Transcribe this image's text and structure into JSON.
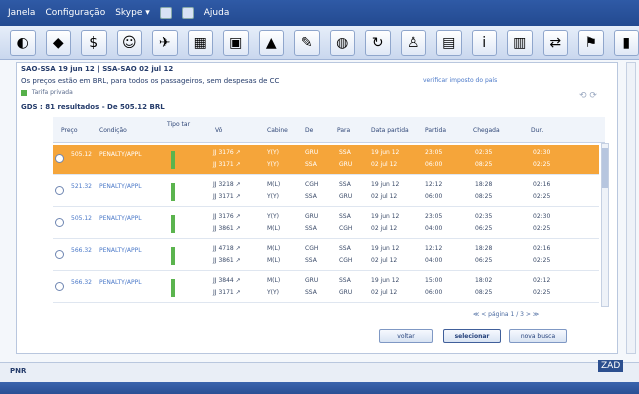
{
  "menubar": {
    "items": [
      "Janela",
      "Configuração",
      "Skype ▾",
      "Ajuda"
    ]
  },
  "toolbar": {
    "icons": [
      "app-icon",
      "shield-icon",
      "dollar-icon",
      "people-icon",
      "plane-icon",
      "calendar-icon",
      "print-icon",
      "chart-icon",
      "tools-icon",
      "globe-icon",
      "refresh-icon",
      "user-icon",
      "browser-icon",
      "info-icon",
      "book-icon",
      "exchange-icon",
      "flag-icon",
      "lock-icon"
    ]
  },
  "header": {
    "route": "SAO-SSA 19 jun 12 | SSA-SAO 02 jul 12",
    "note": "Os preços estão em BRL, para todos os passageiros, sem despesas de CC",
    "link": "verificar imposto do país"
  },
  "legend": {
    "label": "Tarifa privada"
  },
  "results": {
    "summary": "GDS : 81 resultados - De 505.12 BRL"
  },
  "table": {
    "headers": [
      "Preço",
      "Condição",
      "Tipo tar",
      "Vô",
      "Cabine",
      "De",
      "Para",
      "Data partida",
      "Partida",
      "Chegada",
      "Dur."
    ],
    "rows": [
      {
        "price": "505.12",
        "condition": "PENALTY/APPL",
        "flights": [
          "JJ 3176 ↗",
          "JJ 3171 ↗"
        ],
        "cabin": [
          "Y(Y)",
          "Y(Y)"
        ],
        "from": [
          "GRU",
          "SSA"
        ],
        "to": [
          "SSA",
          "GRU"
        ],
        "date": [
          "19 jun 12",
          "02 jul 12"
        ],
        "dep": [
          "23:05",
          "06:00"
        ],
        "arr": [
          "02:35",
          "08:25"
        ],
        "dur": [
          "02:30",
          "02:25"
        ],
        "selected": true
      },
      {
        "price": "521.32",
        "condition": "PENALTY/APPL",
        "flights": [
          "JJ 3218 ↗",
          "JJ 3171 ↗"
        ],
        "cabin": [
          "M(L)",
          "Y(Y)"
        ],
        "from": [
          "CGH",
          "SSA"
        ],
        "to": [
          "SSA",
          "GRU"
        ],
        "date": [
          "19 jun 12",
          "02 jul 12"
        ],
        "dep": [
          "12:12",
          "06:00"
        ],
        "arr": [
          "18:28",
          "08:25"
        ],
        "dur": [
          "02:16",
          "02:25"
        ],
        "selected": false
      },
      {
        "price": "505.12",
        "condition": "PENALTY/APPL",
        "flights": [
          "JJ 3176 ↗",
          "JJ 3861 ↗"
        ],
        "cabin": [
          "Y(Y)",
          "M(L)"
        ],
        "from": [
          "GRU",
          "SSA"
        ],
        "to": [
          "SSA",
          "CGH"
        ],
        "date": [
          "19 jun 12",
          "02 jul 12"
        ],
        "dep": [
          "23:05",
          "04:00"
        ],
        "arr": [
          "02:35",
          "06:25"
        ],
        "dur": [
          "02:30",
          "02:25"
        ],
        "selected": false
      },
      {
        "price": "566.32",
        "condition": "PENALTY/APPL",
        "flights": [
          "JJ 4718 ↗",
          "JJ 3861 ↗"
        ],
        "cabin": [
          "M(L)",
          "M(L)"
        ],
        "from": [
          "CGH",
          "SSA"
        ],
        "to": [
          "SSA",
          "CGH"
        ],
        "date": [
          "19 jun 12",
          "02 jul 12"
        ],
        "dep": [
          "12:12",
          "04:00"
        ],
        "arr": [
          "18:28",
          "06:25"
        ],
        "dur": [
          "02:16",
          "02:25"
        ],
        "selected": false
      },
      {
        "price": "566.32",
        "condition": "PENALTY/APPL",
        "flights": [
          "JJ 3844 ↗",
          "JJ 3171 ↗"
        ],
        "cabin": [
          "M(L)",
          "Y(Y)"
        ],
        "from": [
          "GRU",
          "SSA"
        ],
        "to": [
          "SSA",
          "GRU"
        ],
        "date": [
          "19 jun 12",
          "02 jul 12"
        ],
        "dep": [
          "15:00",
          "06:00"
        ],
        "arr": [
          "18:02",
          "08:25"
        ],
        "dur": [
          "02:12",
          "02:25"
        ],
        "selected": false
      }
    ]
  },
  "pager": {
    "text": "página 1 / 3"
  },
  "buttons": {
    "voltar": "voltar",
    "selecionar": "selecionar",
    "nova_busca": "nova busca"
  },
  "bottom": {
    "pnr_tab": "PNR",
    "brand": "ZAD"
  },
  "colors": {
    "accent": "#2f5aa6",
    "selected_row": "#f5a53a",
    "private_fare": "#5bb44e"
  }
}
